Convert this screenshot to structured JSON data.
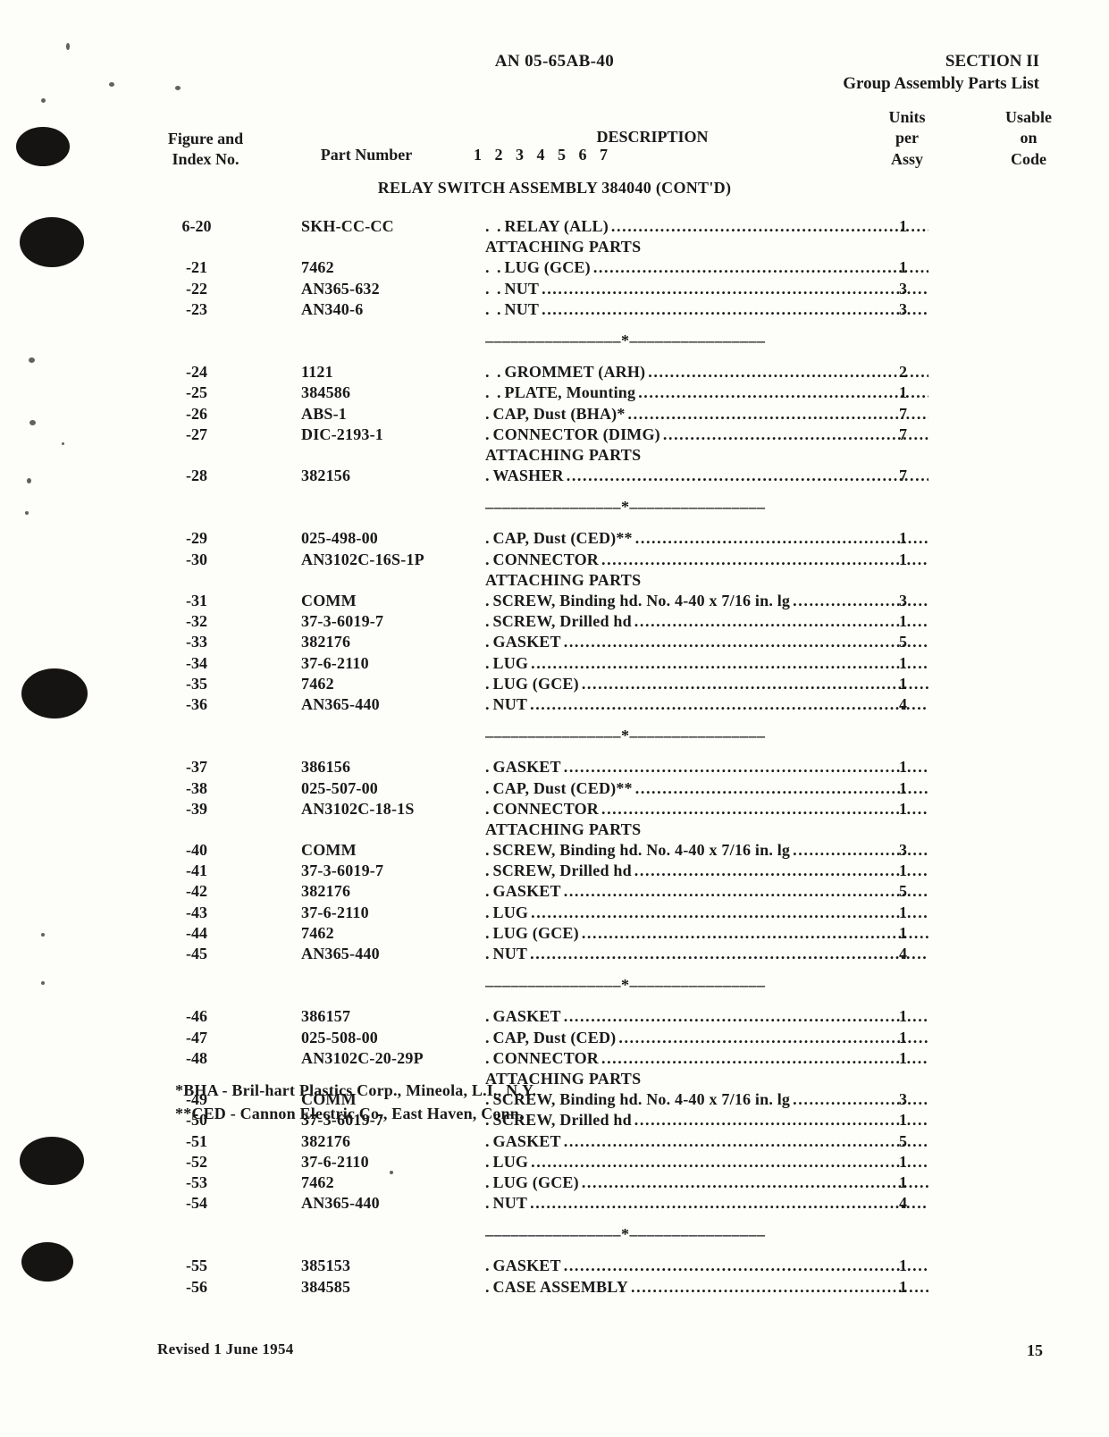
{
  "header": {
    "doc_number": "AN 05-65AB-40",
    "section": "SECTION  II",
    "section_subtitle": "Group Assembly Parts List"
  },
  "columns": {
    "figure_line1": "Figure and",
    "figure_line2": "Index No.",
    "part_number": "Part Number",
    "description": "DESCRIPTION",
    "description_digits": "1 2 3 4 5 6 7",
    "units_line1": "Units",
    "units_line2": "per",
    "units_line3": "Assy",
    "usable_line1": "Usable",
    "usable_line2": "on",
    "usable_line3": "Code"
  },
  "assembly_title": "RELAY SWITCH ASSEMBLY 384040 (CONT'D)",
  "labels": {
    "attaching_parts": "ATTACHING PARTS"
  },
  "rows": [
    {
      "type": "item",
      "index": "6-20",
      "part": "SKH-CC-CC",
      "indent": ". .",
      "desc": "RELAY (ALL)",
      "qty": "1"
    },
    {
      "type": "subhead",
      "text": "ATTACHING PARTS"
    },
    {
      "type": "item",
      "index": "-21",
      "part": "7462",
      "indent": ". .",
      "desc": "LUG (GCE)",
      "qty": "1"
    },
    {
      "type": "item",
      "index": "-22",
      "part": "AN365-632",
      "indent": ". .",
      "desc": "NUT",
      "qty": "3"
    },
    {
      "type": "item",
      "index": "-23",
      "part": "AN340-6",
      "indent": ". .",
      "desc": "NUT",
      "qty": "3"
    },
    {
      "type": "separator"
    },
    {
      "type": "item",
      "index": "-24",
      "part": "1121",
      "indent": ". .",
      "desc": "GROMMET (ARH)",
      "qty": "2"
    },
    {
      "type": "item",
      "index": "-25",
      "part": "384586",
      "indent": ". .",
      "desc": "PLATE, Mounting",
      "qty": "1"
    },
    {
      "type": "item",
      "index": "-26",
      "part": "ABS-1",
      "indent": ".",
      "desc": "CAP, Dust (BHA)*",
      "qty": "7"
    },
    {
      "type": "item",
      "index": "-27",
      "part": "DIC-2193-1",
      "indent": ".",
      "desc": "CONNECTOR (DIMG)",
      "qty": "7"
    },
    {
      "type": "subhead",
      "text": "ATTACHING PARTS"
    },
    {
      "type": "item",
      "index": "-28",
      "part": "382156",
      "indent": ".",
      "desc": "WASHER",
      "qty": "7"
    },
    {
      "type": "separator"
    },
    {
      "type": "item",
      "index": "-29",
      "part": "025-498-00",
      "indent": ".",
      "desc": "CAP, Dust (CED)**",
      "qty": "1"
    },
    {
      "type": "item",
      "index": "-30",
      "part": "AN3102C-16S-1P",
      "indent": ".",
      "desc": "CONNECTOR",
      "qty": "1"
    },
    {
      "type": "subhead",
      "text": "ATTACHING PARTS"
    },
    {
      "type": "item",
      "index": "-31",
      "part": "COMM",
      "indent": ".",
      "desc": "SCREW, Binding hd. No. 4-40 x 7/16 in. lg",
      "qty": "3"
    },
    {
      "type": "item",
      "index": "-32",
      "part": "37-3-6019-7",
      "indent": ".",
      "desc": "SCREW, Drilled hd",
      "qty": "1"
    },
    {
      "type": "item",
      "index": "-33",
      "part": "382176",
      "indent": ".",
      "desc": "GASKET",
      "qty": "5"
    },
    {
      "type": "item",
      "index": "-34",
      "part": "37-6-2110",
      "indent": ".",
      "desc": "LUG",
      "qty": "1"
    },
    {
      "type": "item",
      "index": "-35",
      "part": "7462",
      "indent": ".",
      "desc": "LUG (GCE)",
      "qty": "1"
    },
    {
      "type": "item",
      "index": "-36",
      "part": "AN365-440",
      "indent": ".",
      "desc": "NUT",
      "qty": "4"
    },
    {
      "type": "separator"
    },
    {
      "type": "item",
      "index": "-37",
      "part": "386156",
      "indent": ".",
      "desc": "GASKET",
      "qty": "1"
    },
    {
      "type": "item",
      "index": "-38",
      "part": "025-507-00",
      "indent": ".",
      "desc": "CAP, Dust (CED)**",
      "qty": "1"
    },
    {
      "type": "item",
      "index": "-39",
      "part": "AN3102C-18-1S",
      "indent": ".",
      "desc": "CONNECTOR",
      "qty": "1"
    },
    {
      "type": "subhead",
      "text": "ATTACHING PARTS"
    },
    {
      "type": "item",
      "index": "-40",
      "part": "COMM",
      "indent": ".",
      "desc": "SCREW, Binding hd. No. 4-40 x  7/16 in.  lg",
      "qty": "3"
    },
    {
      "type": "item",
      "index": "-41",
      "part": "37-3-6019-7",
      "indent": ".",
      "desc": "SCREW, Drilled hd",
      "qty": "1"
    },
    {
      "type": "item",
      "index": "-42",
      "part": "382176",
      "indent": ".",
      "desc": "GASKET",
      "qty": "5"
    },
    {
      "type": "item",
      "index": "-43",
      "part": "37-6-2110",
      "indent": ".",
      "desc": "LUG",
      "qty": "1"
    },
    {
      "type": "item",
      "index": "-44",
      "part": "7462",
      "indent": ".",
      "desc": "LUG (GCE)",
      "qty": "1"
    },
    {
      "type": "item",
      "index": "-45",
      "part": "AN365-440",
      "indent": ".",
      "desc": "NUT",
      "qty": "4"
    },
    {
      "type": "separator"
    },
    {
      "type": "item",
      "index": "-46",
      "part": "386157",
      "indent": ".",
      "desc": "GASKET",
      "qty": "1"
    },
    {
      "type": "item",
      "index": "-47",
      "part": "025-508-00",
      "indent": ".",
      "desc": "CAP, Dust (CED)",
      "qty": "1"
    },
    {
      "type": "item",
      "index": "-48",
      "part": "AN3102C-20-29P",
      "indent": ".",
      "desc": "CONNECTOR",
      "qty": "1"
    },
    {
      "type": "subhead",
      "text": "ATTACHING PARTS"
    },
    {
      "type": "item",
      "index": "-49",
      "part": "COMM",
      "indent": ".",
      "desc": "SCREW, Binding hd. No. 4-40 x 7/16 in.  lg",
      "qty": "3"
    },
    {
      "type": "item",
      "index": "-50",
      "part": "37-3-6019-7",
      "indent": ".",
      "desc": "SCREW, Drilled hd",
      "qty": "1"
    },
    {
      "type": "item",
      "index": "-51",
      "part": "382176",
      "indent": ".",
      "desc": "GASKET",
      "qty": "5"
    },
    {
      "type": "item",
      "index": "-52",
      "part": "37-6-2110",
      "indent": ".",
      "desc": "LUG",
      "qty": "1"
    },
    {
      "type": "item",
      "index": "-53",
      "part": "7462",
      "indent": ".",
      "desc": "LUG (GCE)",
      "qty": "1"
    },
    {
      "type": "item",
      "index": "-54",
      "part": "AN365-440",
      "indent": ".",
      "desc": "NUT",
      "qty": "4"
    },
    {
      "type": "separator"
    },
    {
      "type": "item",
      "index": "-55",
      "part": "385153",
      "indent": ".",
      "desc": "GASKET",
      "qty": "1"
    },
    {
      "type": "item",
      "index": "-56",
      "part": "384585",
      "indent": ".",
      "desc": "CASE ASSEMBLY",
      "qty": "1"
    }
  ],
  "footnotes": [
    "*BHA - Bril-hart Plastics Corp., Mineola, L.I., N.Y.",
    "**CED - Cannon Electric Co., East Haven, Conn."
  ],
  "footer": {
    "revised": "Revised  1 June 1954",
    "page_number": "15"
  }
}
